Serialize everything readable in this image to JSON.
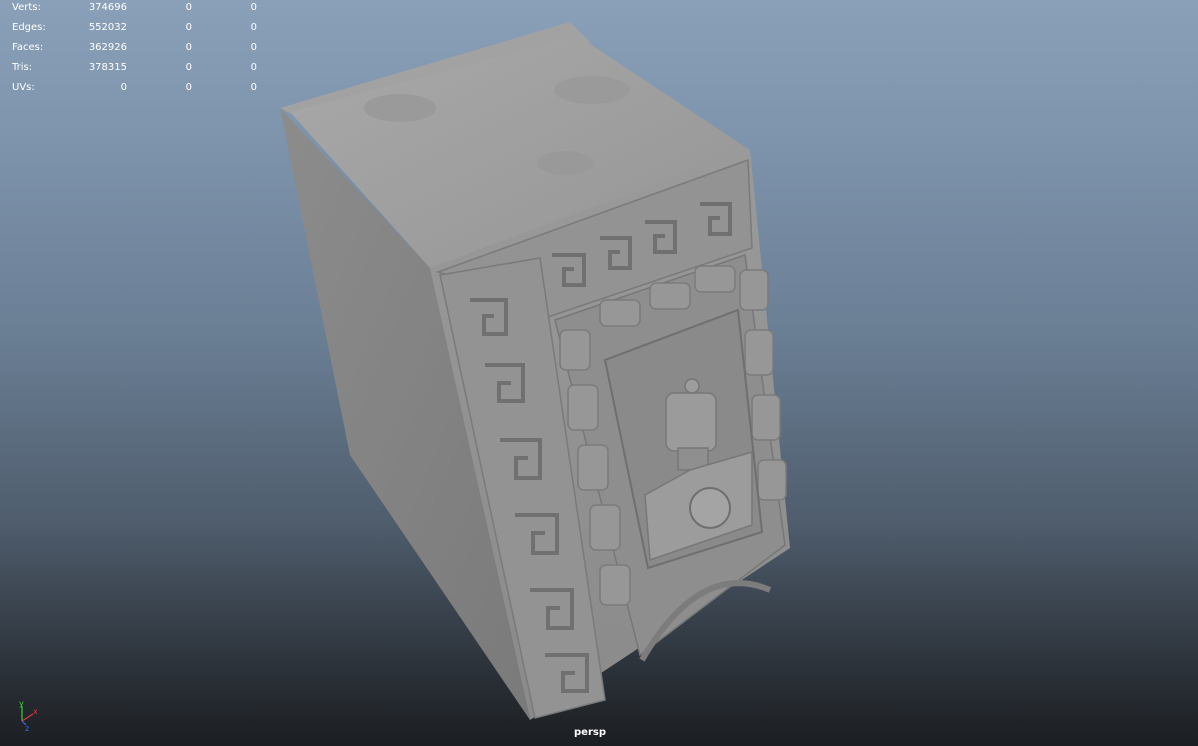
{
  "hud": {
    "rows": [
      {
        "label": "Verts:",
        "v1": "374696",
        "v2": "0",
        "v3": "0"
      },
      {
        "label": "Edges:",
        "v1": "552032",
        "v2": "0",
        "v3": "0"
      },
      {
        "label": "Faces:",
        "v1": "362926",
        "v2": "0",
        "v3": "0"
      },
      {
        "label": "Tris:",
        "v1": "378315",
        "v2": "0",
        "v3": "0"
      },
      {
        "label": "UVs:",
        "v1": "0",
        "v2": "0",
        "v3": "0"
      }
    ]
  },
  "camera": {
    "name": "persp"
  },
  "axis": {
    "y": "y",
    "x": "x",
    "z": "z",
    "y_color": "#3ad13a",
    "x_color": "#e23a3a",
    "z_color": "#3a6ae2"
  },
  "colors": {
    "model_base": "#8f8f8f"
  }
}
